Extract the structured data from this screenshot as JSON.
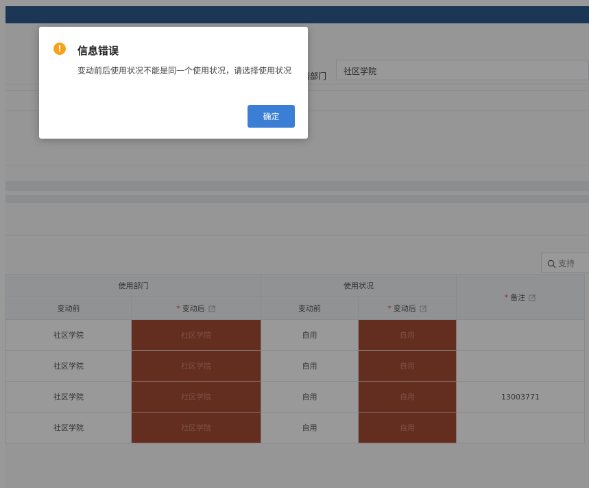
{
  "form": {
    "dept_label": "请部门",
    "dept_value": "社区学院"
  },
  "search": {
    "placeholder": "支持"
  },
  "table": {
    "group_dept": "使用部门",
    "group_status": "使用状况",
    "col_before": "变动前",
    "col_after": "变动后",
    "col_remark": "备注",
    "rows": [
      {
        "dept_before": "社区学院",
        "dept_after": "社区学院",
        "status_before": "自用",
        "status_after": "自用",
        "remark": ""
      },
      {
        "dept_before": "社区学院",
        "dept_after": "社区学院",
        "status_before": "自用",
        "status_after": "自用",
        "remark": ""
      },
      {
        "dept_before": "社区学院",
        "dept_after": "社区学院",
        "status_before": "自用",
        "status_after": "自用",
        "remark": "13003771"
      },
      {
        "dept_before": "社区学院",
        "dept_after": "社区学院",
        "status_before": "自用",
        "status_after": "自用",
        "remark": ""
      }
    ]
  },
  "dialog": {
    "title": "信息错误",
    "message": "变动前后使用状况不能是同一个使用状况，请选择使用状况",
    "confirm": "确定",
    "icon_glyph": "!"
  },
  "colors": {
    "accent": "#3a7fd5",
    "edited_cell": "#a64b35",
    "warning": "#f7a21b",
    "topbar": "#2f5c8f"
  }
}
